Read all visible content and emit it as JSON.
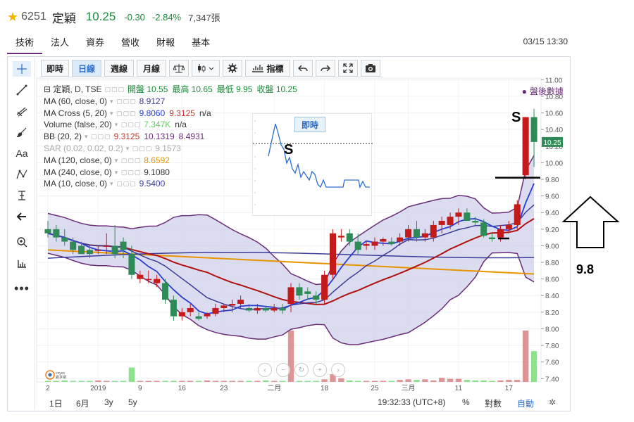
{
  "header": {
    "code": "6251",
    "name": "定穎",
    "price": "10.25",
    "change": "-0.30",
    "change_pct": "-2.84%",
    "volume": "7,347張"
  },
  "nav_tabs": [
    "技術",
    "法人",
    "資券",
    "營收",
    "財報",
    "基本"
  ],
  "timestamp": "03/15 13:30",
  "toolbar": {
    "btn_intraday": "即時",
    "btn_daily": "日線",
    "btn_weekly": "週線",
    "btn_monthly": "月線",
    "btn_indicators": "指標"
  },
  "indicators": [
    {
      "label": "定穎, D, TSE",
      "values": [
        "開盤 10.55",
        "最高 10.65",
        "最低 9.95",
        "收盤 10.25"
      ],
      "colors": [
        "#333333"
      ]
    },
    {
      "label": "MA (60, close, 0)",
      "values": [
        "8.9127"
      ],
      "colors": [
        "#3b3b9a"
      ]
    },
    {
      "label": "MA Cross (5, 20)",
      "values": [
        "9.8060",
        "9.3125",
        "n/a"
      ],
      "colors": [
        "#2a3fd0",
        "#c0392b",
        "#333333"
      ]
    },
    {
      "label": "Volume (false, 20)",
      "values": [
        "7.347K",
        "n/a"
      ],
      "colors": [
        "#5cd65c",
        "#333333"
      ]
    },
    {
      "label": "BB (20, 2)",
      "values": [
        "9.3125",
        "10.1319",
        "8.4931"
      ],
      "colors": [
        "#c0392b",
        "#6a2c78",
        "#6a2c78"
      ]
    },
    {
      "label": "SAR (0.02, 0.02, 0.2)",
      "values": [
        "9.1573"
      ],
      "colors": [
        "#aaaaaa"
      ],
      "dim": true
    },
    {
      "label": "MA (120, close, 0)",
      "values": [
        "8.6592"
      ],
      "colors": [
        "#e69500"
      ]
    },
    {
      "label": "MA (240, close, 0)",
      "values": [
        "9.1080"
      ],
      "colors": [
        "#333333"
      ]
    },
    {
      "label": "MA (10, close, 0)",
      "values": [
        "9.5400"
      ],
      "colors": [
        "#3b3b9a"
      ]
    }
  ],
  "post_market": "盤後數據",
  "inset_button": "即時",
  "annotations": {
    "s1": "S",
    "s2": "S",
    "level": "9.8"
  },
  "bottom_bar": {
    "r1d": "1日",
    "r6m": "6月",
    "r3y": "3y",
    "r5y": "5y",
    "clock": "19:32:33 (UTC+8)",
    "pct": "%",
    "log": "對數",
    "auto": "自動"
  },
  "last_price_tag": "10.25",
  "chart_data": {
    "type": "candlestick",
    "y_axis_labels": [
      "11.00",
      "10.80",
      "10.60",
      "10.40",
      "10.20",
      "10.00",
      "9.80",
      "9.60",
      "9.40",
      "9.20",
      "9.00",
      "8.80",
      "8.60",
      "8.40",
      "8.20",
      "8.00",
      "7.80",
      "7.60",
      "7.40"
    ],
    "x_axis_labels": [
      "2",
      "2019",
      "9",
      "16",
      "23",
      "二月",
      "18",
      "25",
      "三月",
      "11",
      "17"
    ],
    "ylim": [
      7.36,
      11.02
    ],
    "candles": [
      {
        "o": 9.2,
        "h": 9.3,
        "l": 9.1,
        "c": 9.15
      },
      {
        "o": 9.2,
        "h": 9.25,
        "l": 9.05,
        "c": 9.1
      },
      {
        "o": 9.1,
        "h": 9.2,
        "l": 9.0,
        "c": 9.05
      },
      {
        "o": 9.05,
        "h": 9.1,
        "l": 8.9,
        "c": 8.95
      },
      {
        "o": 9.0,
        "h": 9.05,
        "l": 8.9,
        "c": 8.9
      },
      {
        "o": 8.95,
        "h": 9.0,
        "l": 8.85,
        "c": 8.9
      },
      {
        "o": 8.95,
        "h": 9.0,
        "l": 8.9,
        "c": 8.95
      },
      {
        "o": 9.0,
        "h": 9.15,
        "l": 8.9,
        "c": 9.0
      },
      {
        "o": 9.0,
        "h": 9.25,
        "l": 8.85,
        "c": 8.9
      },
      {
        "o": 9.05,
        "h": 9.1,
        "l": 8.85,
        "c": 8.95
      },
      {
        "o": 8.9,
        "h": 9.0,
        "l": 8.6,
        "c": 8.65
      },
      {
        "o": 8.6,
        "h": 8.7,
        "l": 8.55,
        "c": 8.65
      },
      {
        "o": 8.6,
        "h": 8.7,
        "l": 8.55,
        "c": 8.6
      },
      {
        "o": 8.55,
        "h": 8.65,
        "l": 8.5,
        "c": 8.6
      },
      {
        "o": 8.55,
        "h": 8.6,
        "l": 8.3,
        "c": 8.35
      },
      {
        "o": 8.35,
        "h": 8.4,
        "l": 8.1,
        "c": 8.15
      },
      {
        "o": 8.15,
        "h": 8.25,
        "l": 8.1,
        "c": 8.2
      },
      {
        "o": 8.2,
        "h": 8.3,
        "l": 8.15,
        "c": 8.25
      },
      {
        "o": 8.15,
        "h": 8.2,
        "l": 8.1,
        "c": 8.12
      },
      {
        "o": 8.15,
        "h": 8.2,
        "l": 8.12,
        "c": 8.18
      },
      {
        "o": 8.18,
        "h": 8.3,
        "l": 8.15,
        "c": 8.25
      },
      {
        "o": 8.25,
        "h": 8.3,
        "l": 8.2,
        "c": 8.28
      },
      {
        "o": 8.28,
        "h": 8.35,
        "l": 8.2,
        "c": 8.3
      },
      {
        "o": 8.3,
        "h": 8.4,
        "l": 8.25,
        "c": 8.35
      },
      {
        "o": 8.25,
        "h": 8.3,
        "l": 8.2,
        "c": 8.22
      },
      {
        "o": 8.22,
        "h": 8.3,
        "l": 8.18,
        "c": 8.25
      },
      {
        "o": 8.25,
        "h": 8.28,
        "l": 8.2,
        "c": 8.22
      },
      {
        "o": 8.22,
        "h": 8.3,
        "l": 8.2,
        "c": 8.25
      },
      {
        "o": 8.25,
        "h": 8.3,
        "l": 8.18,
        "c": 8.22
      },
      {
        "o": 8.3,
        "h": 8.55,
        "l": 8.2,
        "c": 8.5
      },
      {
        "o": 8.5,
        "h": 8.55,
        "l": 8.35,
        "c": 8.4
      },
      {
        "o": 8.45,
        "h": 8.5,
        "l": 8.35,
        "c": 8.42
      },
      {
        "o": 8.4,
        "h": 8.45,
        "l": 8.3,
        "c": 8.35
      },
      {
        "o": 8.35,
        "h": 8.7,
        "l": 8.3,
        "c": 8.65
      },
      {
        "o": 8.65,
        "h": 9.2,
        "l": 8.6,
        "c": 9.15
      },
      {
        "o": 9.1,
        "h": 9.2,
        "l": 9.05,
        "c": 9.12
      },
      {
        "o": 9.15,
        "h": 9.2,
        "l": 9.0,
        "c": 9.05
      },
      {
        "o": 9.05,
        "h": 9.15,
        "l": 8.9,
        "c": 8.95
      },
      {
        "o": 9.0,
        "h": 9.05,
        "l": 8.95,
        "c": 9.02
      },
      {
        "o": 9.0,
        "h": 9.1,
        "l": 8.95,
        "c": 9.05
      },
      {
        "o": 9.05,
        "h": 9.1,
        "l": 9.0,
        "c": 9.08
      },
      {
        "o": 9.05,
        "h": 9.1,
        "l": 9.0,
        "c": 9.02
      },
      {
        "o": 9.05,
        "h": 9.15,
        "l": 9.0,
        "c": 9.1
      },
      {
        "o": 9.1,
        "h": 9.25,
        "l": 9.05,
        "c": 9.2
      },
      {
        "o": 9.2,
        "h": 9.3,
        "l": 9.05,
        "c": 9.1
      },
      {
        "o": 9.1,
        "h": 9.2,
        "l": 9.05,
        "c": 9.15
      },
      {
        "o": 9.1,
        "h": 9.3,
        "l": 9.05,
        "c": 9.25
      },
      {
        "o": 9.25,
        "h": 9.35,
        "l": 9.15,
        "c": 9.3
      },
      {
        "o": 9.25,
        "h": 9.4,
        "l": 9.2,
        "c": 9.35
      },
      {
        "o": 9.35,
        "h": 9.45,
        "l": 9.25,
        "c": 9.4
      },
      {
        "o": 9.4,
        "h": 9.45,
        "l": 9.3,
        "c": 9.3
      },
      {
        "o": 9.3,
        "h": 9.35,
        "l": 9.25,
        "c": 9.28
      },
      {
        "o": 9.28,
        "h": 9.32,
        "l": 9.1,
        "c": 9.12
      },
      {
        "o": 9.1,
        "h": 9.15,
        "l": 9.05,
        "c": 9.08
      },
      {
        "o": 9.1,
        "h": 9.25,
        "l": 9.05,
        "c": 9.2
      },
      {
        "o": 9.2,
        "h": 9.3,
        "l": 9.15,
        "c": 9.25
      },
      {
        "o": 9.25,
        "h": 9.55,
        "l": 9.2,
        "c": 9.5
      },
      {
        "o": 9.85,
        "h": 10.55,
        "l": 9.8,
        "c": 10.55
      },
      {
        "o": 10.55,
        "h": 10.65,
        "l": 9.95,
        "c": 10.25
      }
    ],
    "volume_ratio": [
      0.02,
      0.02,
      0.03,
      0.02,
      0.02,
      0.02,
      0.03,
      0.02,
      0.02,
      0.02,
      0.28,
      0.02,
      0.02,
      0.02,
      0.02,
      0.02,
      0.02,
      0.02,
      0.02,
      0.03,
      0.02,
      0.02,
      0.02,
      0.02,
      0.02,
      0.02,
      0.03,
      0.02,
      0.02,
      1.0,
      0.02,
      0.02,
      0.02,
      0.05,
      0.15,
      0.07,
      0.03,
      0.02,
      0.02,
      0.02,
      0.02,
      0.02,
      0.04,
      0.05,
      0.04,
      0.05,
      0.03,
      0.08,
      0.06,
      0.06,
      0.04,
      0.03,
      0.03,
      0.02,
      0.03,
      0.04,
      0.04,
      1.0,
      0.6
    ]
  }
}
